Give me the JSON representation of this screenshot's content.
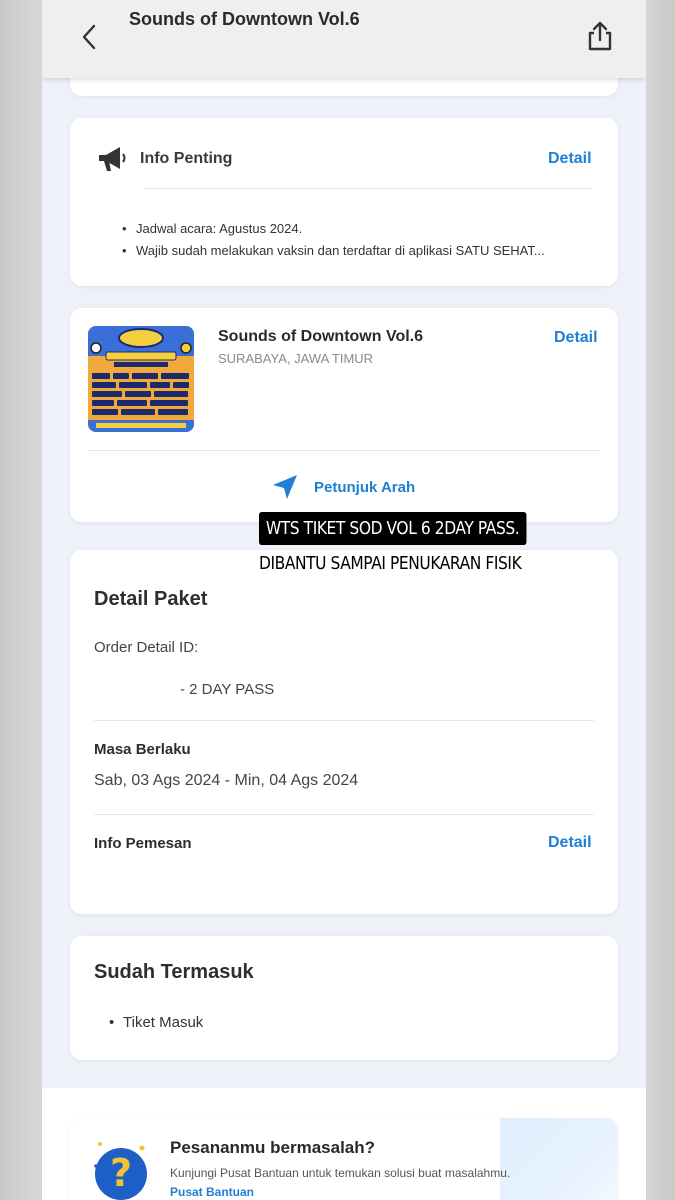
{
  "header": {
    "title": "Sounds of Downtown Vol.6"
  },
  "info_penting": {
    "title": "Info Penting",
    "detail_label": "Detail",
    "items": [
      "Jadwal acara: Agustus 2024.",
      "Wajib sudah melakukan vaksin dan terdaftar di aplikasi SATU SEHAT..."
    ]
  },
  "event": {
    "name": "Sounds of Downtown Vol.6",
    "location": "SURABAYA, JAWA TIMUR",
    "detail_label": "Detail",
    "direction_label": "Petunjuk Arah"
  },
  "overlay": {
    "line1": "WTS TIKET SOD VOL 6 2DAY PASS.",
    "line2": "DIBANTU SAMPAI PENUKARAN FISIK"
  },
  "detail_paket": {
    "title": "Detail Paket",
    "order_label": "Order Detail ID:",
    "package": "- 2 DAY PASS",
    "validity_label": "Masa Berlaku",
    "validity_value": "Sab, 03 Ags 2024 - Min, 04 Ags 2024",
    "booking_info_label": "Info Pemesan",
    "detail_label": "Detail"
  },
  "sudah_termasuk": {
    "title": "Sudah Termasuk",
    "items": [
      "Tiket Masuk"
    ]
  },
  "help": {
    "title": "Pesananmu bermasalah?",
    "description": "Kunjungi Pusat Bantuan untuk temukan solusi buat masalahmu.",
    "link": "Pusat Bantuan"
  }
}
